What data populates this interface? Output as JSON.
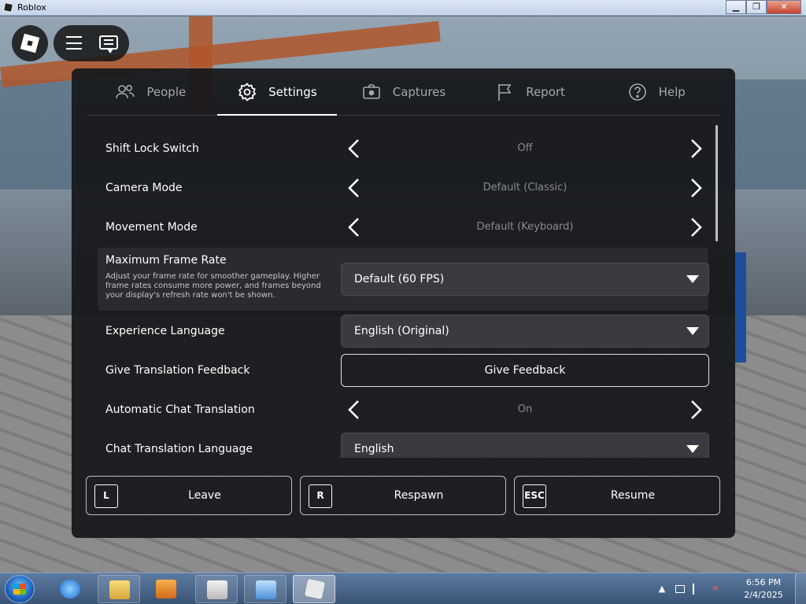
{
  "window": {
    "title": "Roblox",
    "minimize": "▁",
    "restore": "❐",
    "close": "✕"
  },
  "tabs": [
    {
      "label": "People",
      "icon": "people-icon"
    },
    {
      "label": "Settings",
      "icon": "gear-icon"
    },
    {
      "label": "Captures",
      "icon": "camera-icon"
    },
    {
      "label": "Report",
      "icon": "flag-icon"
    },
    {
      "label": "Help",
      "icon": "help-icon"
    }
  ],
  "active_tab": "Settings",
  "settings": {
    "shift_lock": {
      "label": "Shift Lock Switch",
      "value": "Off"
    },
    "camera_mode": {
      "label": "Camera Mode",
      "value": "Default (Classic)"
    },
    "movement_mode": {
      "label": "Movement Mode",
      "value": "Default (Keyboard)"
    },
    "frame_rate": {
      "label": "Maximum Frame Rate",
      "description": "Adjust your frame rate for smoother gameplay. Higher frame rates consume more power, and frames beyond your display's refresh rate won't be shown.",
      "value": "Default (60 FPS)"
    },
    "experience_language": {
      "label": "Experience Language",
      "value": "English (Original)"
    },
    "translation_feedback": {
      "label": "Give Translation Feedback",
      "button": "Give Feedback"
    },
    "auto_chat_translation": {
      "label": "Automatic Chat Translation",
      "value": "On"
    },
    "chat_translation_language": {
      "label": "Chat Translation Language",
      "value": "English"
    }
  },
  "actions": {
    "leave": {
      "key": "L",
      "label": "Leave"
    },
    "respawn": {
      "key": "R",
      "label": "Respawn"
    },
    "resume": {
      "key": "ESC",
      "label": "Resume"
    }
  },
  "taskbar": {
    "clock_time": "6:56 PM",
    "clock_date": "2/4/2025",
    "tray_arrow": "▲"
  }
}
